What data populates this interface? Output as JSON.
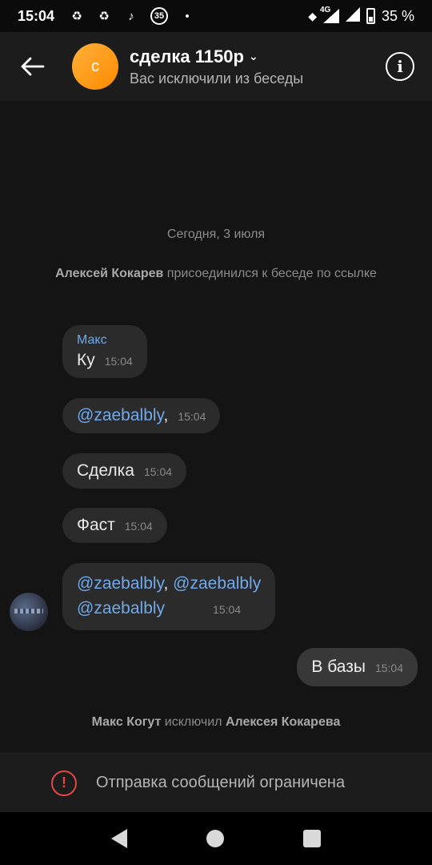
{
  "status_bar": {
    "time": "15:04",
    "notif_badge": "35",
    "network": "4G",
    "battery": "35 %"
  },
  "header": {
    "avatar_letter": "с",
    "title": "сделка 1150р",
    "subtitle": "Вас исключили из беседы"
  },
  "chat": {
    "date": "Сегодня, 3 июля",
    "system_join": {
      "name": "Алексей Кокарев",
      "text": "присоединился к беседе по ссылке"
    },
    "messages": [
      {
        "sender": "Макс",
        "text": "Ку",
        "time": "15:04"
      },
      {
        "mention": "@zaebalbly",
        "suffix": ",",
        "time": "15:04"
      },
      {
        "text": "Сделка",
        "time": "15:04"
      },
      {
        "text": "Фаст",
        "time": "15:04"
      },
      {
        "mention1": "@zaebalbly",
        "sep": ", ",
        "mention2": "@zaebalbly",
        "mention3": "@zaebalbly",
        "time": "15:04"
      }
    ],
    "outgoing": {
      "text": "В базы",
      "time": "15:04"
    },
    "system_kick": {
      "actor": "Макс Когут",
      "action": "исключил",
      "target": "Алексея Кокарева"
    }
  },
  "restriction": {
    "text": "Отправка сообщений ограничена"
  },
  "colors": {
    "accent": "#71aaeb",
    "warning": "#e64646",
    "avatar_orange": "#ff9c1a"
  }
}
